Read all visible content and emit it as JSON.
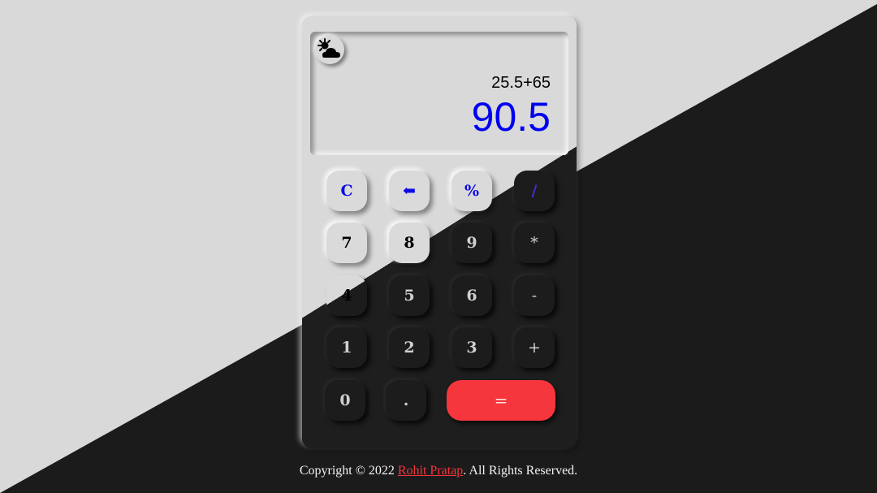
{
  "display": {
    "expression": "25.5+65",
    "result": "90.5",
    "theme_icon": "sun-cloud-icon"
  },
  "keys": {
    "clear": "C",
    "backspace": "⬅",
    "percent": "%",
    "divide": "/",
    "seven": "7",
    "eight": "8",
    "nine": "9",
    "multiply": "*",
    "four": "4",
    "five": "5",
    "six": "6",
    "minus": "-",
    "one": "1",
    "two": "2",
    "three": "3",
    "plus": "+",
    "zero": "0",
    "decimal": ".",
    "equals": "="
  },
  "footer": {
    "prefix": "Copyright © 2022 ",
    "author": "Rohit Pratap",
    "suffix": ". All Rights Reserved."
  },
  "colors": {
    "background_light": "#d9d9d9",
    "background_dark": "#1b1b1b",
    "result_blue": "#0000f0",
    "accent_red": "#f5363c"
  }
}
